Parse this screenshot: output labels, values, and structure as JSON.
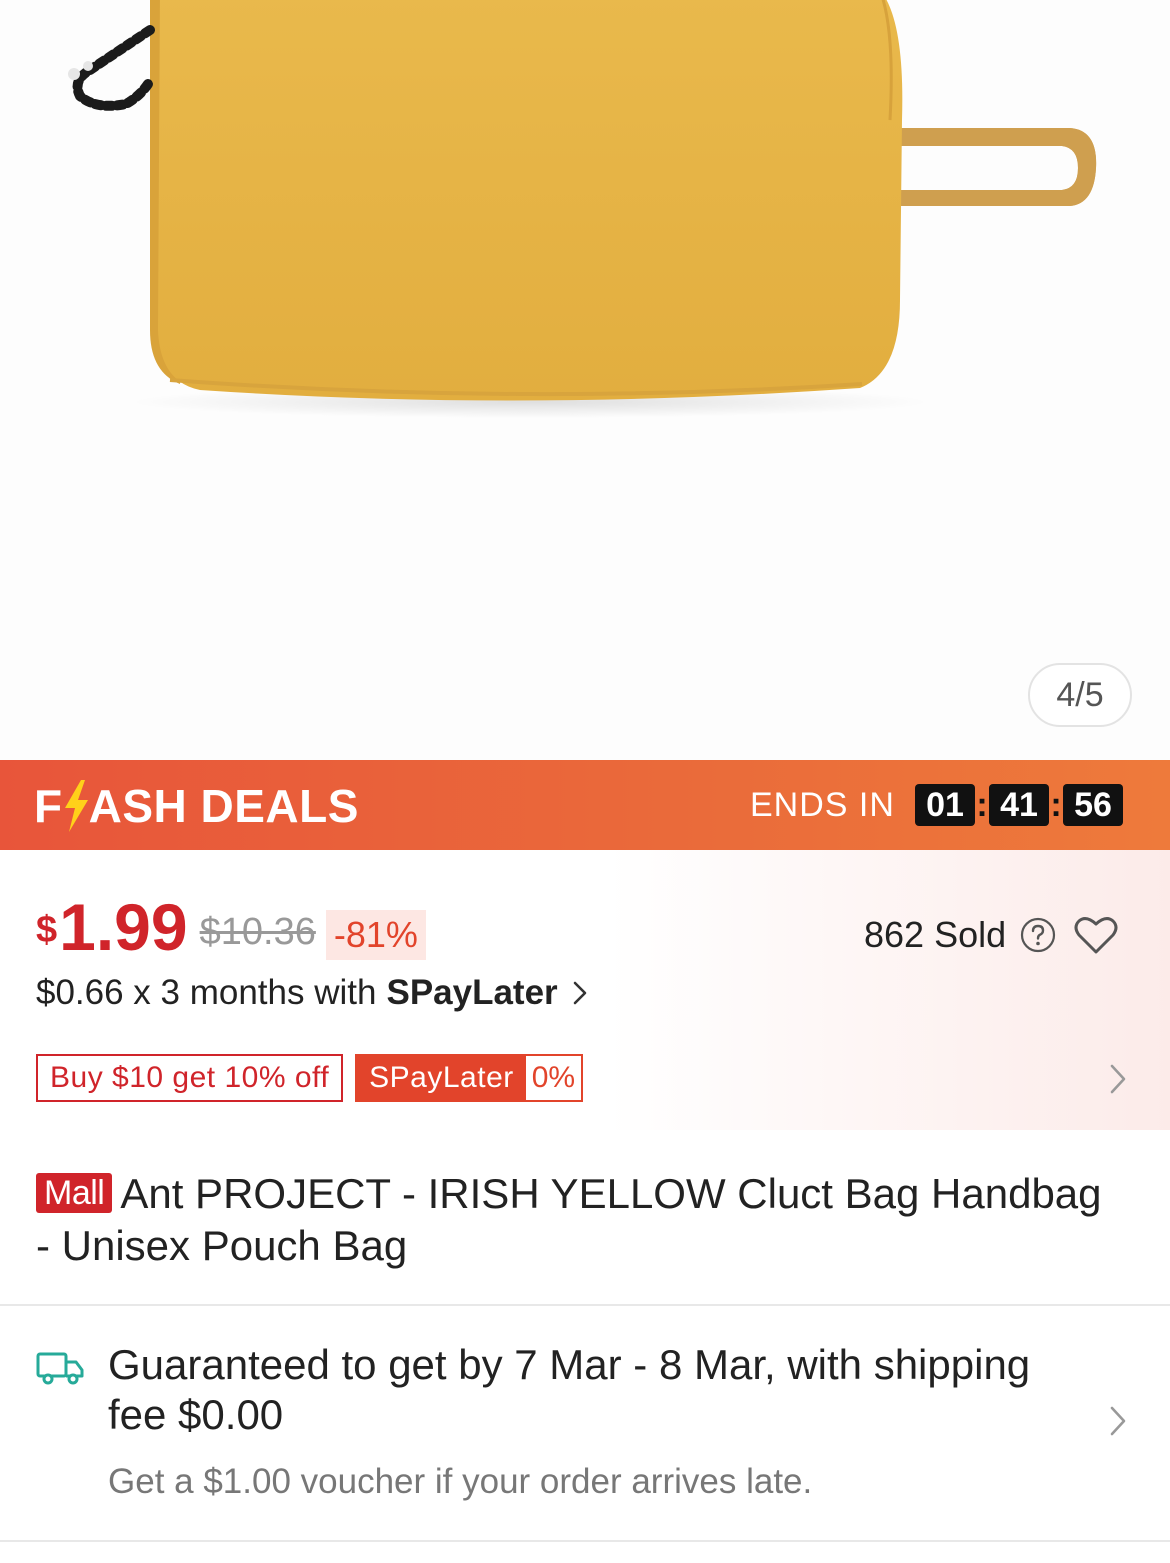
{
  "gallery": {
    "counter": "4/5"
  },
  "flash_deals": {
    "logo_before": "F",
    "logo_after": "ASH DEALS",
    "ends_label": "ENDS IN",
    "hours": "01",
    "minutes": "41",
    "seconds": "56"
  },
  "price": {
    "currency": "$",
    "current": "1.99",
    "original": "$10.36",
    "discount": "-81%",
    "sold": "862 Sold",
    "installment_prefix": "$0.66 x 3 months with",
    "installment_brand": "SPayLater"
  },
  "tags": {
    "voucher": "Buy $10 get 10% off",
    "spay_label": "SPayLater",
    "spay_rate": "0%"
  },
  "product": {
    "badge": "Mall",
    "title": "Ant PROJECT - IRISH YELLOW Cluct Bag Handbag - Unisex Pouch Bag"
  },
  "shipping": {
    "guarantee": "Guaranteed to get by 7 Mar - 8 Mar, with shipping fee $0.00",
    "voucher_note": "Get a $1.00 voucher if your order arrives late."
  },
  "colors": {
    "brand_red": "#d0242a",
    "flash_orange": "#e8553a",
    "bag_yellow": "#e8b64a",
    "truck_teal": "#26aa99"
  }
}
